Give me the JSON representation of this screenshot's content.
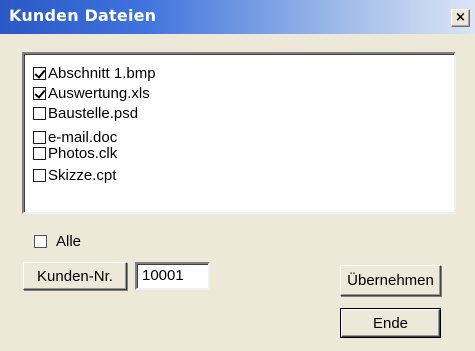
{
  "window": {
    "title": "Kunden Dateien",
    "close_label": "×"
  },
  "files": [
    {
      "name": "Abschnitt 1.bmp",
      "checked": true
    },
    {
      "name": "Auswertung.xls",
      "checked": true
    },
    {
      "name": "Baustelle.psd",
      "checked": false
    },
    {
      "name": "e-mail.doc",
      "checked": false
    },
    {
      "name": "Photos.clk",
      "checked": false
    },
    {
      "name": "Skizze.cpt",
      "checked": false
    }
  ],
  "alle": {
    "label": "Alle",
    "checked": false
  },
  "customer": {
    "button_label": "Kunden-Nr.",
    "number_value": "10001"
  },
  "actions": {
    "apply_label": "Übernehmen",
    "end_label": "Ende"
  }
}
